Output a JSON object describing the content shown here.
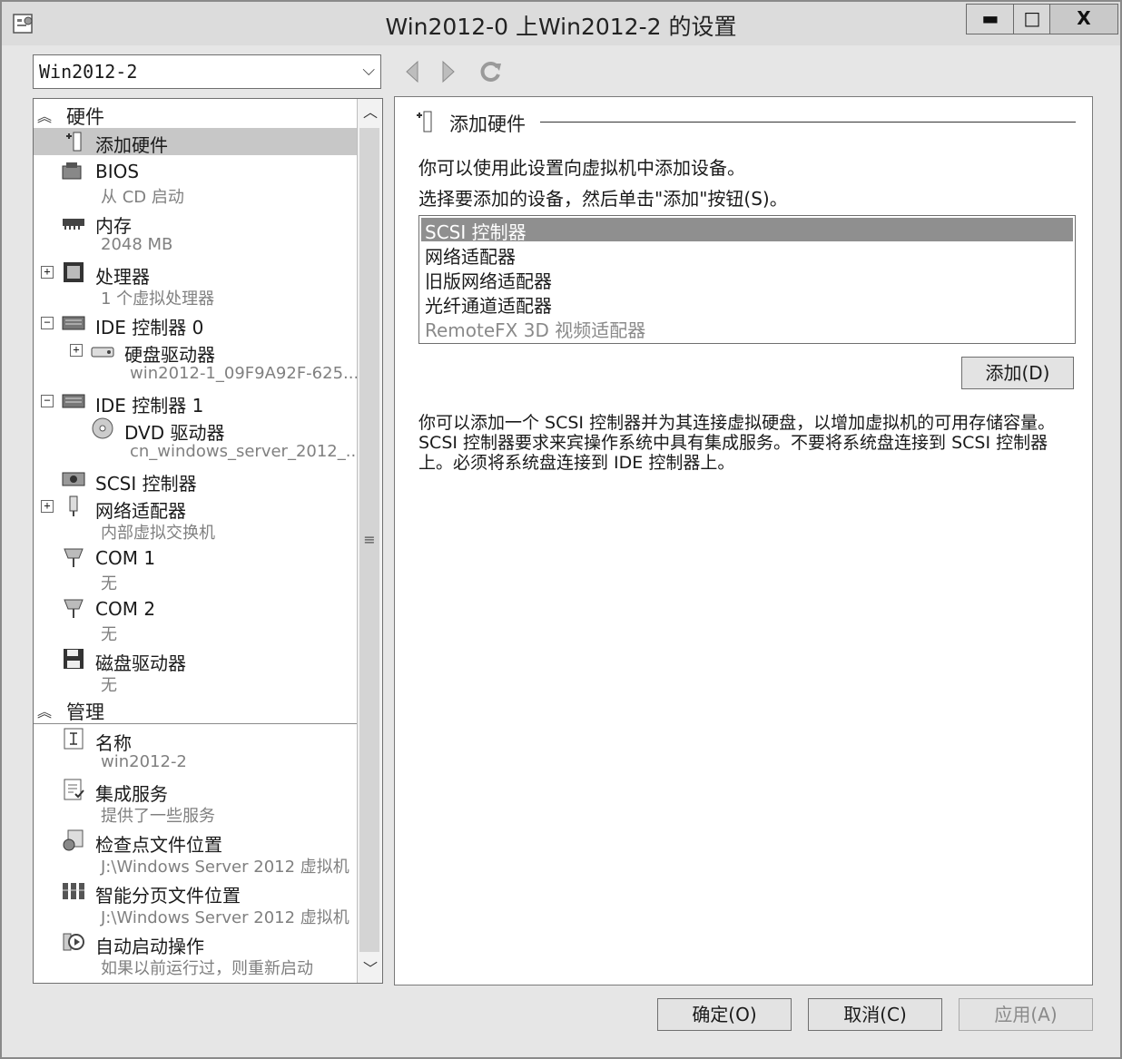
{
  "window": {
    "title": "Win2012-0 上Win2012-2 的设置"
  },
  "title_controls": {
    "minimize": "▬",
    "maximize": "□",
    "close": "X"
  },
  "vm_selector": {
    "value": "Win2012-2"
  },
  "toolbar_icons": [
    "back-arrow-icon",
    "forward-arrow-icon",
    "refresh-icon"
  ],
  "tree": {
    "hardware_header": "硬件",
    "management_header": "管理",
    "hardware_items": [
      {
        "label": "添加硬件",
        "sub": "",
        "icon": "add-hardware-icon"
      },
      {
        "label": "BIOS",
        "sub": "从 CD 启动",
        "icon": "bios-icon"
      },
      {
        "label": "内存",
        "sub": "2048 MB",
        "icon": "memory-icon"
      },
      {
        "label": "处理器",
        "sub": "1 个虚拟处理器",
        "icon": "processor-icon"
      },
      {
        "label": "IDE 控制器 0",
        "sub": "",
        "icon": "ide-controller-icon"
      },
      {
        "label": "硬盘驱动器",
        "sub": "win2012-1_09F9A92F-625...",
        "icon": "hard-disk-icon"
      },
      {
        "label": "IDE 控制器 1",
        "sub": "",
        "icon": "ide-controller-icon"
      },
      {
        "label": "DVD 驱动器",
        "sub": "cn_windows_server_2012_...",
        "icon": "dvd-icon"
      },
      {
        "label": "SCSI 控制器",
        "sub": "",
        "icon": "scsi-icon"
      },
      {
        "label": "网络适配器",
        "sub": "内部虚拟交换机",
        "icon": "network-adapter-icon"
      },
      {
        "label": "COM 1",
        "sub": "无",
        "icon": "com-port-icon"
      },
      {
        "label": "COM 2",
        "sub": "无",
        "icon": "com-port-icon"
      },
      {
        "label": "磁盘驱动器",
        "sub": "无",
        "icon": "floppy-icon"
      }
    ],
    "management_items": [
      {
        "label": "名称",
        "sub": "win2012-2",
        "icon": "name-icon"
      },
      {
        "label": "集成服务",
        "sub": "提供了一些服务",
        "icon": "integration-services-icon"
      },
      {
        "label": "检查点文件位置",
        "sub": "J:\\Windows Server 2012 虚拟机",
        "icon": "checkpoint-icon"
      },
      {
        "label": "智能分页文件位置",
        "sub": "J:\\Windows Server 2012 虚拟机",
        "icon": "smart-paging-icon"
      },
      {
        "label": "自动启动操作",
        "sub": "如果以前运行过，则重新启动",
        "icon": "auto-start-icon"
      }
    ]
  },
  "detail": {
    "title": "添加硬件",
    "description1": "你可以使用此设置向虚拟机中添加设备。",
    "description2": "选择要添加的设备，然后单击\"添加\"按钮(S)。",
    "devices": [
      {
        "label": "SCSI 控制器",
        "state": "selected"
      },
      {
        "label": "网络适配器",
        "state": "normal"
      },
      {
        "label": "旧版网络适配器",
        "state": "normal"
      },
      {
        "label": "光纤通道适配器",
        "state": "normal"
      },
      {
        "label": "RemoteFX 3D 视频适配器",
        "state": "disabled"
      }
    ],
    "add_button": "添加(D)",
    "help_text": "你可以添加一个 SCSI 控制器并为其连接虚拟硬盘，以增加虚拟机的可用存储容量。SCSI 控制器要求来宾操作系统中具有集成服务。不要将系统盘连接到 SCSI 控制器上。必须将系统盘连接到 IDE 控制器上。"
  },
  "footer": {
    "ok": "确定(O)",
    "cancel": "取消(C)",
    "apply": "应用(A)"
  },
  "colors": {
    "selection": "#c7c7c7",
    "list_selection": "#8f8f8f",
    "window_bg": "#e6e6e6"
  }
}
